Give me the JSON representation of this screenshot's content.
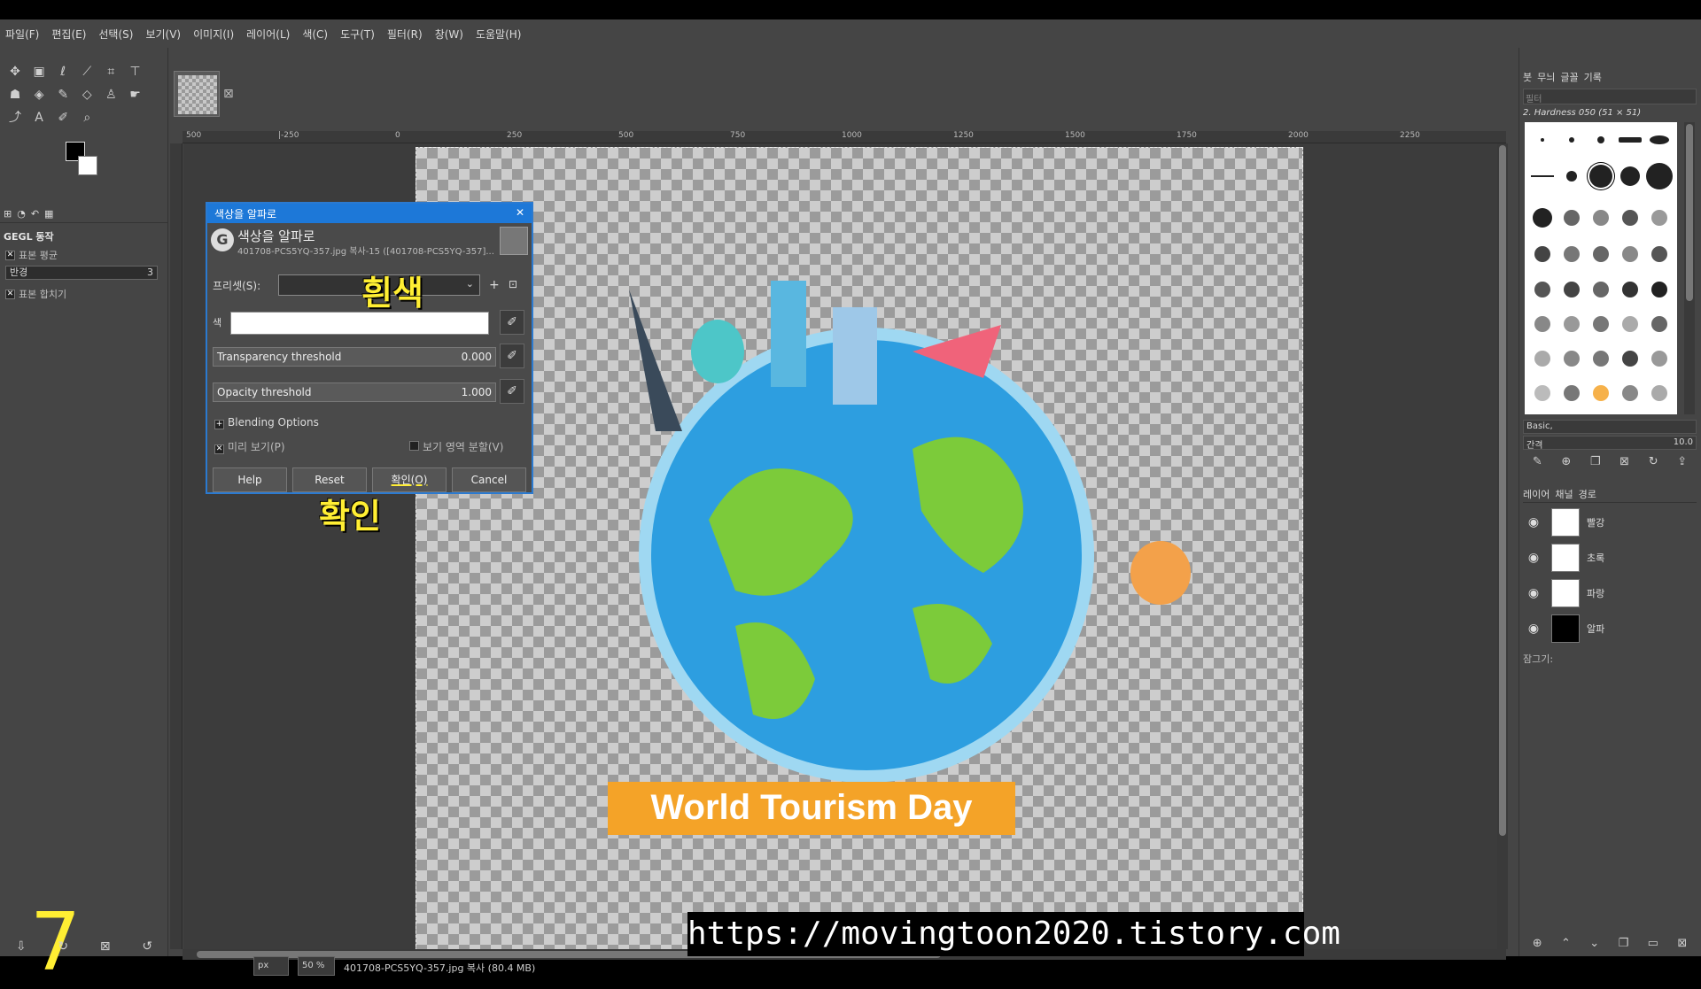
{
  "menu": [
    "파일(F)",
    "편집(E)",
    "선택(S)",
    "보기(V)",
    "이미지(I)",
    "레이어(L)",
    "색(C)",
    "도구(T)",
    "필터(R)",
    "창(W)",
    "도움말(H)"
  ],
  "toolbox": {
    "tool_options_title": "GEGL 동작",
    "sample_average_label": "표본 평균",
    "radius_label": "반경",
    "radius_value": "3",
    "sample_merged_label": "표본 합치기"
  },
  "step_number": "7",
  "ruler_ticks": [
    "500",
    "|-250",
    "0",
    "250",
    "500",
    "750",
    "1000",
    "1250",
    "1500",
    "1750",
    "2000",
    "2250"
  ],
  "dialog": {
    "window_title": "색상을 알파로",
    "heading": "색상을 알파로",
    "subheading": "401708-PCS5YQ-357.jpg 복사-15 ([401708-PCS5YQ-357]...",
    "preset_label": "프리셋(S):",
    "color_label": "색",
    "transparency_label": "Transparency threshold",
    "transparency_value": "0.000",
    "opacity_label": "Opacity threshold",
    "opacity_value": "1.000",
    "blending_label": "Blending Options",
    "preview_label": "미리 보기(P)",
    "split_label": "보기 영역 분할(V)",
    "help_btn": "Help",
    "reset_btn": "Reset",
    "ok_btn": "확인(O)",
    "cancel_btn": "Cancel"
  },
  "annotations": {
    "white_note": "흰색",
    "ok_note": "확인"
  },
  "canvas_banner": "World Tourism Day",
  "status": {
    "unit": "px",
    "zoom": "50 %",
    "filename": "401708-PCS5YQ-357.jpg 복사 (80.4 MB)"
  },
  "url_overlay": "https://movingtoon2020.tistory.com",
  "dock": {
    "tabs": [
      "붓",
      "무늬",
      "글꼴",
      "기록"
    ],
    "filter_placeholder": "필터",
    "brush_name": "2. Hardness 050 (51 × 51)",
    "brush_set": "Basic,",
    "spacing_label": "간격",
    "spacing_value": "10.0",
    "layer_tabs": [
      "레이어",
      "채널",
      "경로"
    ],
    "layers": [
      "빨강",
      "초록",
      "파랑",
      "알파"
    ],
    "lock_label": "잠그기:"
  }
}
